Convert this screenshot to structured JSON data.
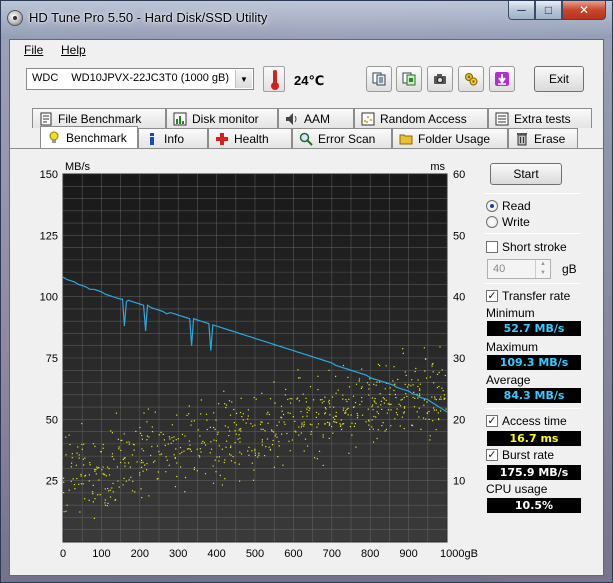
{
  "window": {
    "title": "HD Tune Pro 5.50 - Hard Disk/SSD Utility",
    "controls": {
      "minimize": "─",
      "maximize": "□",
      "close": "✕"
    }
  },
  "menu": {
    "file": "File",
    "help": "Help"
  },
  "toolbar": {
    "drive_vendor": "WDC",
    "drive_model": "WD10JPVX-22JC3T0 (1000 gB)",
    "temperature": "24℃",
    "exit_label": "Exit",
    "icons": [
      "copy-text-icon",
      "copy-screenshot-icon",
      "camera-icon",
      "options-icon",
      "save-icon"
    ]
  },
  "tabs": {
    "row_top": [
      "File Benchmark",
      "Disk monitor",
      "AAM",
      "Random Access",
      "Extra tests"
    ],
    "row_bottom": [
      "Benchmark",
      "Info",
      "Health",
      "Error Scan",
      "Folder Usage",
      "Erase"
    ],
    "active": "Benchmark"
  },
  "side": {
    "start_label": "Start",
    "read_label": "Read",
    "write_label": "Write",
    "mode_selected": "Read",
    "short_stroke_label": "Short stroke",
    "short_stroke_checked": false,
    "short_stroke_value": "40",
    "short_stroke_unit": "gB",
    "transfer_rate_label": "Transfer rate",
    "transfer_rate_checked": true,
    "minimum_label": "Minimum",
    "minimum_value": "52.7 MB/s",
    "maximum_label": "Maximum",
    "maximum_value": "109.3 MB/s",
    "average_label": "Average",
    "average_value": "84.3 MB/s",
    "access_time_label": "Access time",
    "access_time_checked": true,
    "access_time_value": "16.7 ms",
    "burst_rate_label": "Burst rate",
    "burst_rate_checked": true,
    "burst_rate_value": "175.9 MB/s",
    "cpu_label": "CPU usage",
    "cpu_value": "10.5%",
    "colors": {
      "transfer": "#33ccff",
      "access": "#ffff00",
      "cpu": "#ffffff"
    }
  },
  "chart_data": {
    "type": "line",
    "ylabel": "MB/s",
    "y2label": "ms",
    "ylim": [
      0,
      150
    ],
    "y2lim": [
      0,
      60
    ],
    "xlim": [
      0,
      1000
    ],
    "xunit": "gB",
    "xticks": [
      0,
      100,
      200,
      300,
      400,
      500,
      600,
      700,
      800,
      900,
      1000
    ],
    "yticks": [
      25,
      50,
      75,
      100,
      125,
      150
    ],
    "y2ticks": [
      10,
      20,
      30,
      40,
      50,
      60
    ],
    "grid": true,
    "colors": {
      "background": "#202020",
      "grid": "#6e6e6e",
      "line": "#2aa8e0",
      "scatter": "#e6e61e"
    },
    "series": [
      {
        "type": "line",
        "values_x": [
          0,
          10,
          20,
          30,
          40,
          50,
          60,
          70,
          80,
          90,
          100,
          110,
          120,
          130,
          140,
          150,
          155,
          160,
          165,
          170,
          180,
          190,
          200,
          210,
          215,
          220,
          225,
          230,
          240,
          250,
          260,
          270,
          280,
          290,
          300,
          310,
          320,
          330,
          335,
          340,
          350,
          360,
          370,
          380,
          385,
          390,
          400,
          410,
          420,
          430,
          440,
          450,
          460,
          470,
          480,
          490,
          500,
          510,
          520,
          530,
          540,
          550,
          560,
          570,
          580,
          590,
          600,
          610,
          620,
          630,
          640,
          650,
          660,
          670,
          680,
          690,
          700,
          710,
          720,
          730,
          740,
          750,
          760,
          770,
          780,
          790,
          800,
          810,
          820,
          830,
          840,
          850,
          860,
          870,
          880,
          890,
          900,
          910,
          920,
          930,
          940,
          950,
          960,
          970,
          980,
          990,
          1000
        ],
        "values": [
          108,
          107,
          106.5,
          106,
          105,
          104.5,
          104,
          103,
          103,
          102.5,
          102,
          101,
          100.5,
          100,
          99.5,
          99,
          99,
          88,
          98,
          98.5,
          98,
          97.5,
          97,
          96.5,
          86,
          96.5,
          96,
          95.5,
          95,
          94.5,
          94,
          93,
          93.5,
          93,
          92.5,
          92,
          91.5,
          91,
          80,
          91,
          90.5,
          90,
          89.5,
          89,
          78,
          88.5,
          88,
          87.5,
          87,
          86.5,
          86,
          85.5,
          85,
          84.5,
          84,
          83.5,
          83,
          82.5,
          82,
          81.5,
          81,
          80.5,
          80,
          79.5,
          79,
          78.5,
          78,
          77.5,
          77,
          76.5,
          76,
          75.5,
          75,
          74.5,
          74,
          73.5,
          73,
          72,
          71.5,
          71,
          70.5,
          70,
          69.5,
          69,
          68.5,
          68,
          67,
          66.5,
          66,
          65.5,
          65,
          64.5,
          64,
          63,
          62.5,
          62,
          61.5,
          60.5,
          60,
          59,
          58.5,
          58,
          57,
          56,
          55,
          54,
          53
        ]
      },
      {
        "type": "scatter",
        "axis": "y2",
        "trend_start_ms": 11,
        "trend_end_ms": 25,
        "spread_ms": 7,
        "points": 700
      }
    ]
  }
}
